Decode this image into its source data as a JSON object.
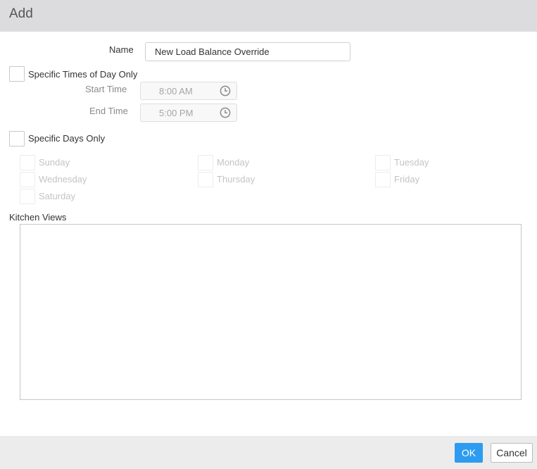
{
  "dialog": {
    "title": "Add"
  },
  "form": {
    "name_label": "Name",
    "name_value": "New Load Balance Override",
    "times_checkbox_label": "Specific Times of Day Only",
    "times_checked": false,
    "start_time_label": "Start Time",
    "start_time_value": "8:00 AM",
    "end_time_label": "End Time",
    "end_time_value": "5:00 PM",
    "days_checkbox_label": "Specific Days Only",
    "days_checked": false,
    "days": {
      "sunday": "Sunday",
      "monday": "Monday",
      "tuesday": "Tuesday",
      "wednesday": "Wednesday",
      "thursday": "Thursday",
      "friday": "Friday",
      "saturday": "Saturday"
    },
    "kitchen_views_label": "Kitchen Views",
    "kitchen_views_items": []
  },
  "footer": {
    "ok_label": "OK",
    "cancel_label": "Cancel"
  },
  "colors": {
    "header_bg": "#dcdcdf",
    "footer_bg": "#ececec",
    "primary_button": "#2d9cf0"
  },
  "icons": {
    "time_picker": "clock-icon"
  }
}
